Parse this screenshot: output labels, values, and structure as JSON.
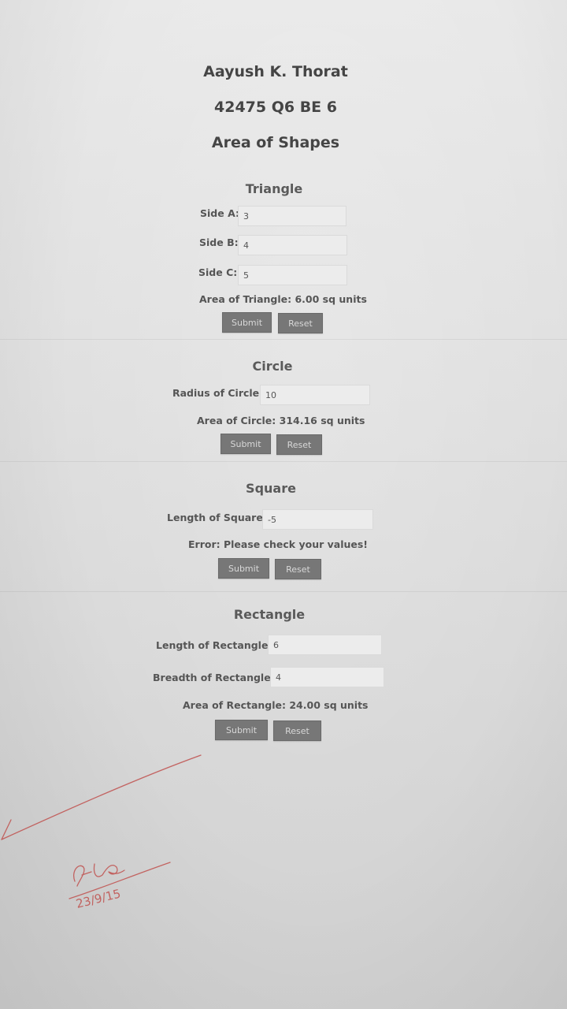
{
  "header": {
    "name": "Aayush K. Thorat",
    "id": "42475 Q6 BE 6",
    "title": "Area of Shapes"
  },
  "triangle": {
    "title": "Triangle",
    "side_a_label": "Side A:",
    "side_a_value": "3",
    "side_b_label": "Side B:",
    "side_b_value": "4",
    "side_c_label": "Side C:",
    "side_c_value": "5",
    "result": "Area of Triangle: 6.00 sq units",
    "submit_label": "Submit",
    "reset_label": "Reset"
  },
  "circle": {
    "title": "Circle",
    "radius_label": "Radius of Circle:",
    "radius_value": "10",
    "result": "Area of Circle: 314.16 sq units",
    "submit_label": "Submit",
    "reset_label": "Reset"
  },
  "square": {
    "title": "Square",
    "length_label": "Length of Square:",
    "length_value": "-5",
    "result": "Error: Please check your values!",
    "submit_label": "Submit",
    "reset_label": "Reset"
  },
  "rectangle": {
    "title": "Rectangle",
    "length_label": "Length of Rectangle:",
    "length_value": "6",
    "breadth_label": "Breadth of Rectangle:",
    "breadth_value": "4",
    "result": "Area of Rectangle: 24.00 sq units",
    "submit_label": "Submit",
    "reset_label": "Reset"
  },
  "annotation": {
    "signature_text": "23/9/15",
    "ink_color": "#c0504d"
  }
}
